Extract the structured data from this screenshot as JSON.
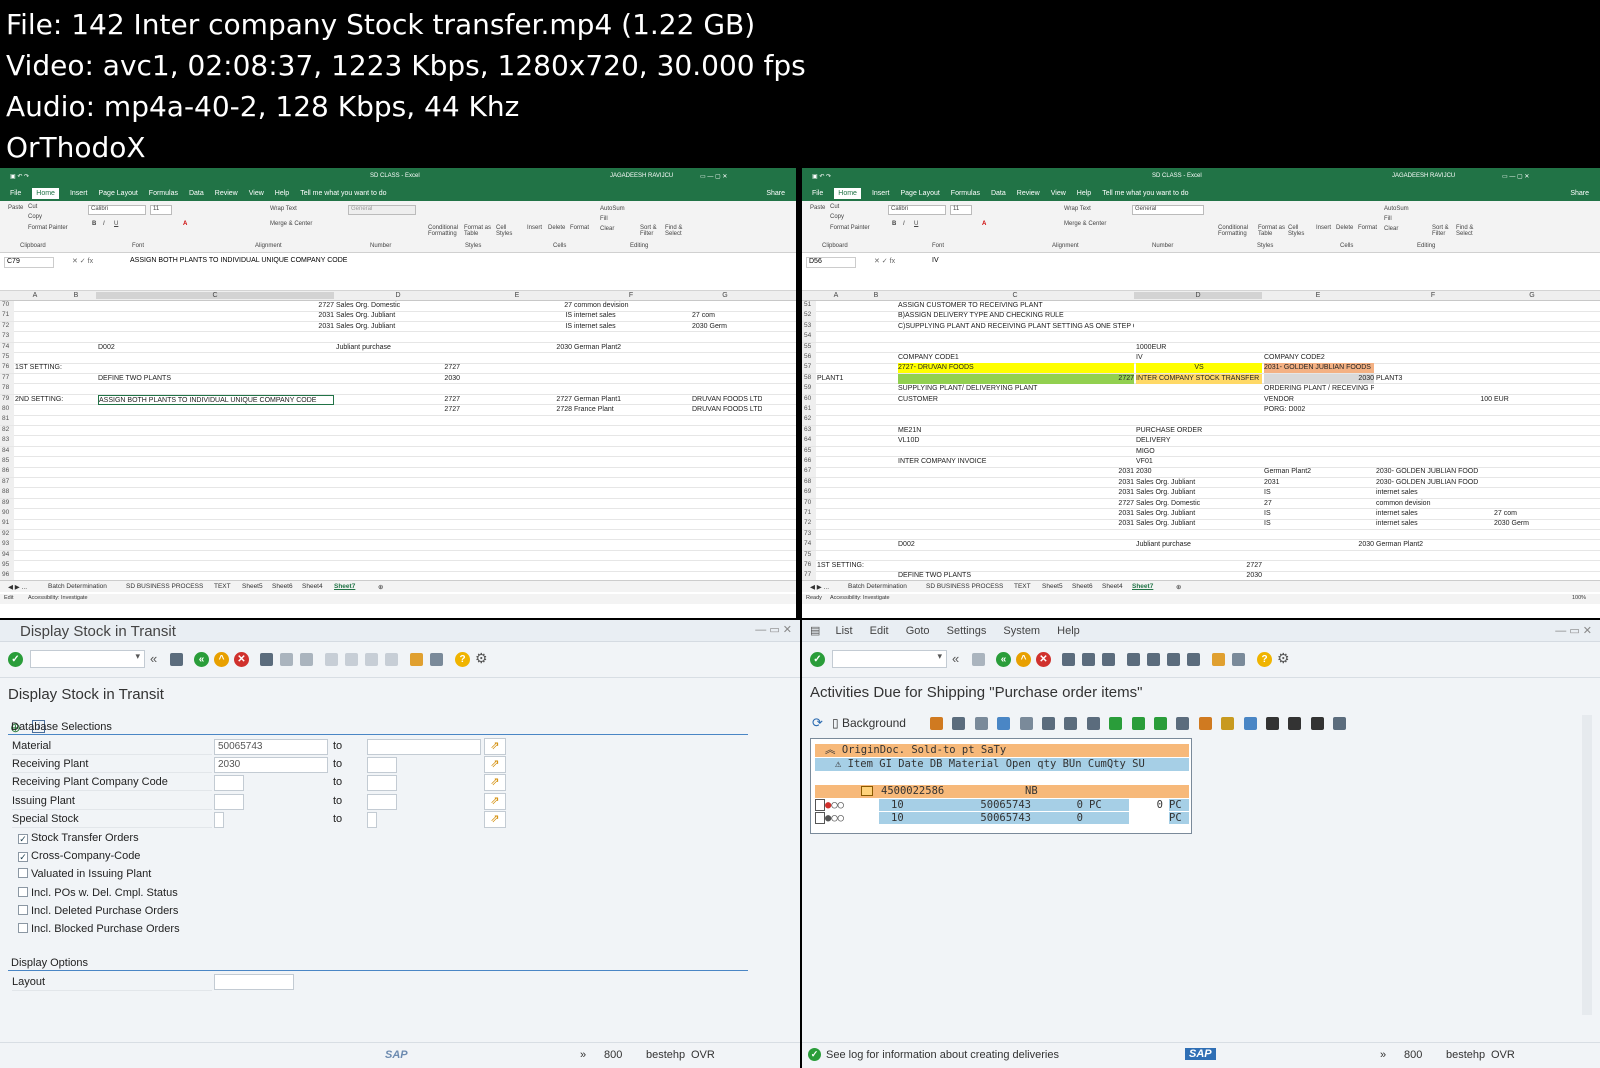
{
  "header": {
    "line1": "File: 142  Inter company Stock transfer.mp4 (1.22 GB)",
    "line2": "Video: avc1, 02:08:37, 1223 Kbps, 1280x720, 30.000 fps",
    "line3": "Audio: mp4a-40-2, 128 Kbps, 44 Khz",
    "line4": "OrThodoX"
  },
  "excel": {
    "title": "SD CLASS  -  Excel",
    "user": "JAGADEESH RAVIJCU",
    "tabs": [
      "File",
      "Home",
      "Insert",
      "Page Layout",
      "Formulas",
      "Data",
      "Review",
      "View",
      "Help"
    ],
    "tellme": "Tell me what you want to do",
    "share": "Share",
    "ribbon": {
      "cut": "Cut",
      "copy": "Copy",
      "paste": "Paste",
      "format_painter": "Format Painter",
      "clipboard": "Clipboard",
      "font": "Calibri",
      "size": "11",
      "font_group": "Font",
      "wrap": "Wrap Text",
      "merge": "Merge & Center",
      "alignment": "Alignment",
      "number_format": "General",
      "number": "Number",
      "cond": "Conditional Formatting",
      "fmt_table": "Format as Table",
      "cell_styles": "Cell Styles",
      "styles": "Styles",
      "insert": "Insert",
      "delete": "Delete",
      "format": "Format",
      "cells": "Cells",
      "autosum": "AutoSum",
      "fill": "Fill",
      "clear": "Clear",
      "sort": "Sort & Filter",
      "find": "Find & Select",
      "editing": "Editing"
    },
    "left": {
      "namebox": "C79",
      "formula": "ASSIGN BOTH PLANTS TO INDIVIDUAL UNIQUE  COMPANY CODE",
      "cols": [
        "A",
        "B",
        "C",
        "D",
        "E",
        "F",
        "G"
      ],
      "rows": [
        {
          "n": "70",
          "c": [
            "",
            "",
            "2727",
            "Sales Org. Domestic",
            "27",
            "common devision",
            ""
          ]
        },
        {
          "n": "71",
          "c": [
            "",
            "",
            "2031",
            "Sales Org. Jubliant",
            "IS",
            "internet sales",
            "27 com"
          ]
        },
        {
          "n": "72",
          "c": [
            "",
            "",
            "2031",
            "Sales Org. Jubliant",
            "IS",
            "internet sales",
            "2030 Germ"
          ]
        },
        {
          "n": "73",
          "c": [
            "",
            "",
            "",
            "",
            "",
            "",
            ""
          ]
        },
        {
          "n": "74",
          "c": [
            "",
            "D002",
            "",
            "Jubliant purchase",
            "2030",
            "German Plant2",
            ""
          ]
        },
        {
          "n": "75",
          "c": [
            "",
            "",
            "",
            "",
            "",
            "",
            ""
          ]
        },
        {
          "n": "76",
          "c": [
            "1ST SETTING:",
            "",
            "",
            "2727",
            "",
            "",
            ""
          ]
        },
        {
          "n": "77",
          "c": [
            "",
            "DEFINE TWO PLANTS",
            "",
            "2030",
            "",
            "",
            ""
          ]
        },
        {
          "n": "78",
          "c": [
            "",
            "",
            "",
            "",
            "",
            "",
            ""
          ]
        },
        {
          "n": "79",
          "c": [
            "2ND SETTING:",
            "ASSIGN BOTH PLANTS TO INDIVIDUAL UNIQUE  COMPANY CODE",
            "",
            "2727",
            "2727",
            "German Plant1",
            "DRUVAN FOODS LTD"
          ]
        },
        {
          "n": "80",
          "c": [
            "",
            "",
            "",
            "2727",
            "2728",
            "France Plant",
            "DRUVAN FOODS LTD"
          ]
        },
        {
          "n": "81",
          "c": [
            "",
            "",
            "",
            "",
            "",
            "",
            ""
          ]
        },
        {
          "n": "82",
          "c": [
            "",
            "",
            "",
            "",
            "",
            "",
            ""
          ]
        },
        {
          "n": "83",
          "c": [
            "",
            "",
            "",
            "",
            "",
            "",
            ""
          ]
        },
        {
          "n": "84",
          "c": [
            "",
            "",
            "",
            "",
            "",
            "",
            ""
          ]
        },
        {
          "n": "85",
          "c": [
            "",
            "",
            "",
            "",
            "",
            "",
            ""
          ]
        },
        {
          "n": "86",
          "c": [
            "",
            "",
            "",
            "",
            "",
            "",
            ""
          ]
        },
        {
          "n": "87",
          "c": [
            "",
            "",
            "",
            "",
            "",
            "",
            ""
          ]
        },
        {
          "n": "88",
          "c": [
            "",
            "",
            "",
            "",
            "",
            "",
            ""
          ]
        },
        {
          "n": "89",
          "c": [
            "",
            "",
            "",
            "",
            "",
            "",
            ""
          ]
        },
        {
          "n": "90",
          "c": [
            "",
            "",
            "",
            "",
            "",
            "",
            ""
          ]
        },
        {
          "n": "91",
          "c": [
            "",
            "",
            "",
            "",
            "",
            "",
            ""
          ]
        },
        {
          "n": "92",
          "c": [
            "",
            "",
            "",
            "",
            "",
            "",
            ""
          ]
        },
        {
          "n": "93",
          "c": [
            "",
            "",
            "",
            "",
            "",
            "",
            ""
          ]
        },
        {
          "n": "94",
          "c": [
            "",
            "",
            "",
            "",
            "",
            "",
            ""
          ]
        },
        {
          "n": "95",
          "c": [
            "",
            "",
            "",
            "",
            "",
            "",
            ""
          ]
        },
        {
          "n": "96",
          "c": [
            "",
            "",
            "",
            "",
            "",
            "",
            ""
          ]
        }
      ]
    },
    "right": {
      "namebox": "D56",
      "formula": "IV",
      "rows": [
        {
          "n": "51",
          "c": [
            "",
            "ASSIGN CUSTOMER TO RECEIVING PLANT",
            "",
            "",
            "",
            "",
            ""
          ]
        },
        {
          "n": "52",
          "c": [
            "",
            "B)ASSIGN DELIVERY TYPE AND CHECKING RULE",
            "",
            "",
            "",
            "",
            ""
          ]
        },
        {
          "n": "53",
          "c": [
            "",
            "C)SUPPLYING PLANT AND RECEIVING PLANT SETTING AS ONE STEP OR TWO STEP",
            "",
            "",
            "",
            "",
            ""
          ]
        },
        {
          "n": "54",
          "c": [
            "",
            "",
            "",
            "",
            "",
            "",
            ""
          ]
        },
        {
          "n": "55",
          "c": [
            "",
            "",
            "1000EUR",
            "",
            "",
            "",
            ""
          ]
        },
        {
          "n": "56",
          "c": [
            "",
            "COMPANY CODE1",
            "IV",
            "COMPANY CODE2",
            "",
            "",
            ""
          ]
        },
        {
          "n": "57",
          "c": [
            "",
            "2727- DRUVAN FOODS",
            "VS",
            "2031- GOLDEN JUBLIAN FOODS",
            "",
            "",
            ""
          ]
        },
        {
          "n": "58",
          "c": [
            "PLANT1",
            "2727",
            "INTER COMPANY STOCK TRANSFER",
            "2030",
            "PLANT3",
            "",
            ""
          ]
        },
        {
          "n": "59",
          "c": [
            "",
            "SUPPLYING PLANT/ DELIVERYING PLANT",
            "",
            "ORDERING PLANT / RECEVING PLANT",
            "",
            "",
            ""
          ]
        },
        {
          "n": "60",
          "c": [
            "",
            "CUSTOMER",
            "",
            "VENDOR",
            "100",
            "EUR",
            ""
          ]
        },
        {
          "n": "61",
          "c": [
            "",
            "",
            "",
            "PORG: D002",
            "",
            "",
            ""
          ]
        },
        {
          "n": "62",
          "c": [
            "",
            "",
            "",
            "",
            "",
            "",
            ""
          ]
        },
        {
          "n": "63",
          "c": [
            "",
            "ME21N",
            "PURCHASE ORDER",
            "",
            "",
            "",
            ""
          ]
        },
        {
          "n": "64",
          "c": [
            "",
            "VL10D",
            "DELIVERY",
            "",
            "",
            "",
            ""
          ]
        },
        {
          "n": "65",
          "c": [
            "",
            "",
            "MIGO",
            "",
            "",
            "",
            ""
          ]
        },
        {
          "n": "66",
          "c": [
            "",
            "INTER COMPANY INVOICE",
            "VF01",
            "",
            "",
            "",
            ""
          ]
        },
        {
          "n": "67",
          "c": [
            "",
            "2031",
            "2030",
            "German Plant2",
            "2030- GOLDEN JUBLIAN FOOD",
            "",
            ""
          ]
        },
        {
          "n": "68",
          "c": [
            "",
            "2031",
            "Sales Org. Jubliant",
            "2031",
            "2030- GOLDEN JUBLIAN FOOD",
            "",
            ""
          ]
        },
        {
          "n": "69",
          "c": [
            "",
            "2031",
            "Sales Org. Jubliant",
            "IS",
            "internet sales",
            "",
            ""
          ]
        },
        {
          "n": "70",
          "c": [
            "",
            "2727",
            "Sales Org. Domestic",
            "27",
            "common devision",
            "",
            ""
          ]
        },
        {
          "n": "71",
          "c": [
            "",
            "2031",
            "Sales Org. Jubliant",
            "IS",
            "internet sales",
            "27 com",
            ""
          ]
        },
        {
          "n": "72",
          "c": [
            "",
            "2031",
            "Sales Org. Jubliant",
            "IS",
            "internet sales",
            "2030 Germ",
            ""
          ]
        },
        {
          "n": "73",
          "c": [
            "",
            "",
            "",
            "",
            "",
            "",
            ""
          ]
        },
        {
          "n": "74",
          "c": [
            "",
            "D002",
            "Jubliant purchase",
            "2030",
            "German Plant2",
            "",
            ""
          ]
        },
        {
          "n": "75",
          "c": [
            "",
            "",
            "",
            "",
            "",
            "",
            ""
          ]
        },
        {
          "n": "76",
          "c": [
            "1ST SETTING:",
            "",
            "2727",
            "",
            "",
            "",
            ""
          ]
        },
        {
          "n": "77",
          "c": [
            "",
            "DEFINE TWO PLANTS",
            "2030",
            "",
            "",
            "",
            ""
          ]
        }
      ]
    },
    "sheets": [
      "Batch Determination",
      "SD BUSINESS PROCESS",
      "TEXT",
      "Sheet5",
      "Sheet6",
      "Sheet4",
      "Sheet7"
    ],
    "status_left": "Edit",
    "status_right": "Ready",
    "accessibility": "Accessibility: Investigate",
    "zoom": "100%"
  },
  "sap_left": {
    "title": "Display Stock in Transit",
    "heading": "Display Stock in Transit",
    "group1": "Database Selections",
    "fields": [
      {
        "label": "Material",
        "from": "50065743",
        "to_label": "to",
        "to": ""
      },
      {
        "label": "Receiving Plant",
        "from": "2030",
        "to_label": "to",
        "to": ""
      },
      {
        "label": "Receiving Plant Company Code",
        "from": "",
        "to_label": "to",
        "to": ""
      },
      {
        "label": "Issuing Plant",
        "from": "",
        "to_label": "to",
        "to": ""
      },
      {
        "label": "Special Stock",
        "from": "",
        "to_label": "to",
        "to": ""
      }
    ],
    "checks": [
      {
        "label": "Stock Transfer Orders",
        "on": "✓"
      },
      {
        "label": "Cross-Company-Code",
        "on": "✓"
      },
      {
        "label": "Valuated in Issuing Plant",
        "on": ""
      },
      {
        "label": "Incl. POs w. Del. Cmpl. Status",
        "on": ""
      },
      {
        "label": "Incl. Deleted Purchase Orders",
        "on": ""
      },
      {
        "label": "Incl. Blocked Purchase Orders",
        "on": ""
      }
    ],
    "group2": "Display Options",
    "layout_label": "Layout",
    "layout_value": "",
    "status": {
      "client": "800",
      "user": "bestehp",
      "mode": "OVR"
    }
  },
  "sap_right": {
    "menu": [
      "List",
      "Edit",
      "Goto",
      "Settings",
      "System",
      "Help"
    ],
    "heading": "Activities Due for Shipping \"Purchase order items\"",
    "background": "Background",
    "hdr1": "OriginDoc. Sold-to pt SaTy",
    "hdr2": "Item GI Date   DB Material Open qty BUn CumQty SU",
    "doc": "4500022586",
    "doc_type": "NB",
    "items": [
      {
        "item": "10",
        "material": "50065743",
        "qty": "0",
        "bun": "PC",
        "cum": "0",
        "su": "PC"
      },
      {
        "item": "10",
        "material": "50065743",
        "qty": "0",
        "bun": "",
        "cum": "",
        "su": "PC"
      }
    ],
    "message": "See log for information about creating deliveries",
    "status": {
      "client": "800",
      "user": "bestehp",
      "mode": "OVR"
    },
    "sap_logo": "SAP"
  },
  "colors": {
    "excel_green": "#217346",
    "sap_blue": "#4a86c5",
    "yellow": "#ffff00",
    "orange": "#f4b183",
    "green": "#92d050"
  }
}
